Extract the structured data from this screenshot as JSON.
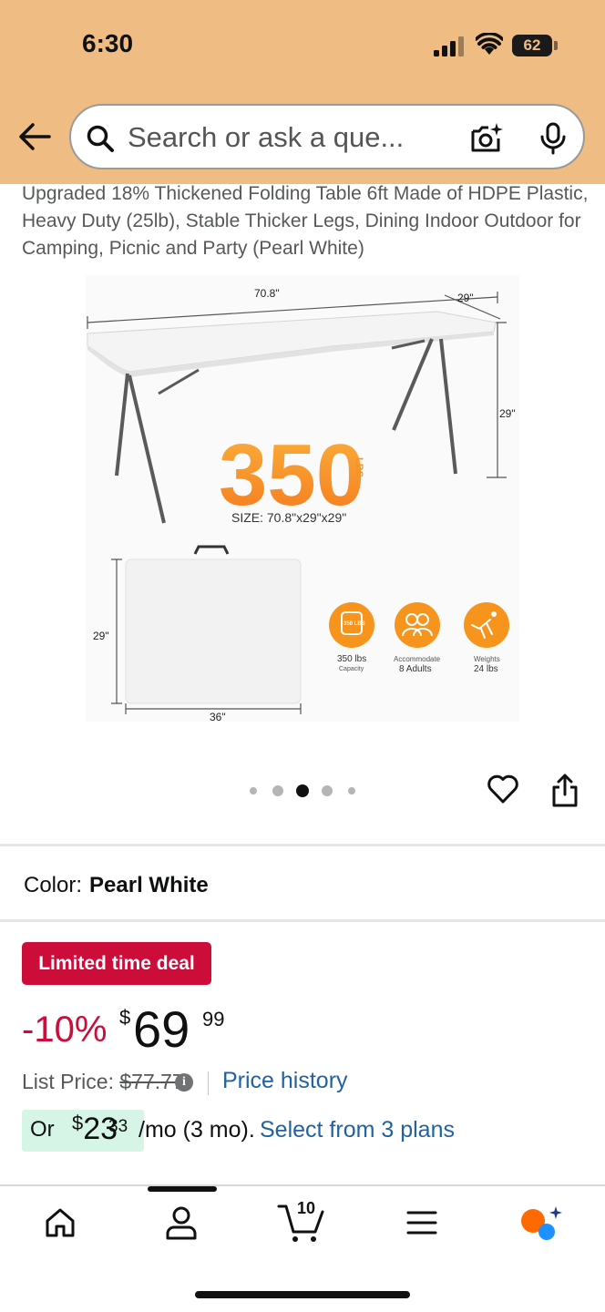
{
  "status_bar": {
    "time": "6:30",
    "battery": "62"
  },
  "search": {
    "placeholder": "Search or ask a que..."
  },
  "product": {
    "title": "Upgraded 18% Thickened Folding Table 6ft Made of HDPE Plastic, Heavy Duty (25lb), Stable Thicker Legs, Dining Indoor Outdoor for Camping, Picnic and Party (Pearl White)"
  },
  "image": {
    "width_label": "70.8\"",
    "depth_label": "29\"",
    "height_label": "29\"",
    "capacity_number": "350",
    "capacity_unit": "LBS",
    "size_text": "SIZE:  70.8\"x29\"x29\"",
    "folded_height_label": "29\"",
    "folded_width_label": "36\"",
    "feature_badge": "350 LBS",
    "features": [
      {
        "line1": "350 lbs",
        "line2": "Capacity"
      },
      {
        "line1": "Accommodate",
        "line2": "8 Adults"
      },
      {
        "line1": "Weights",
        "line2": "24 lbs"
      }
    ]
  },
  "carousel": {
    "count": 5,
    "active": 2
  },
  "color": {
    "label": "Color:",
    "value": "Pearl White"
  },
  "deal": {
    "badge": "Limited time deal"
  },
  "price": {
    "discount": "-10%",
    "currency": "$",
    "whole": "69",
    "fraction": "99",
    "list_label": "List Price:",
    "list_price": "$77.77",
    "history_link": "Price history"
  },
  "installment": {
    "prefix": "Or",
    "currency": "$",
    "whole": "23",
    "fraction": "33",
    "term": "/mo (3 mo).",
    "link": "Select from 3 plans"
  },
  "bottom_nav": {
    "cart_count": "10"
  },
  "colors": {
    "header": "#efbc83",
    "deal": "#cc0c39",
    "link": "#2162a1",
    "accent_orange": "#f7941d"
  }
}
